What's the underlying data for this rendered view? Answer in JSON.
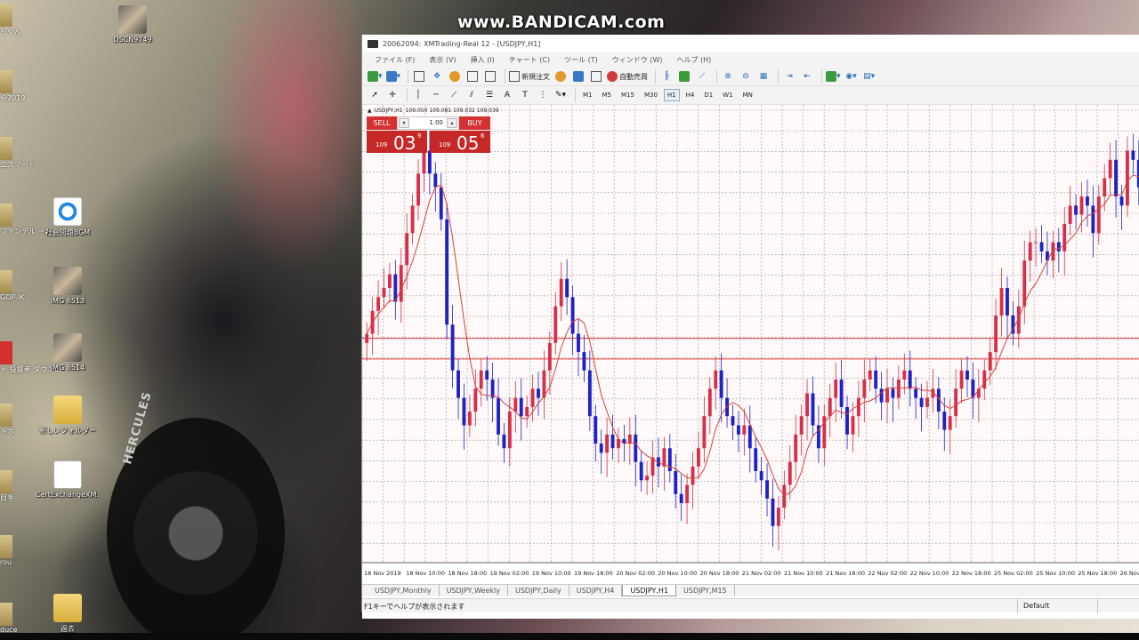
{
  "watermark": "www.BANDICAM.com",
  "desktop": {
    "icons": [
      {
        "label": "DSCN9749",
        "kind": "photo"
      },
      {
        "label": "社会問題BGM",
        "kind": "blue"
      },
      {
        "label": "IMG 6513",
        "kind": "photo"
      },
      {
        "label": "IMG 6514",
        "kind": "photo"
      },
      {
        "label": "新しいフォルダー",
        "kind": "folder"
      },
      {
        "label": "CertExchangeXM...",
        "kind": "pdf"
      },
      {
        "label": "過去",
        "kind": "folder"
      }
    ],
    "edge_labels": [
      "ちゃん",
      "会2019",
      "エスマート",
      "ファンデル ーム",
      "GOP-IK",
      "ト 投資者 ダウンロー...",
      "トホ",
      "目手",
      "rou",
      "duce"
    ],
    "tire_text": "HERCULES"
  },
  "app": {
    "title": "20062094: XMTrading-Real 12 - [USDJPY,H1]",
    "menu": [
      "ファイル (F)",
      "表示 (V)",
      "挿入 (I)",
      "チャート (C)",
      "ツール (T)",
      "ウィンドウ (W)",
      "ヘルプ (H)"
    ],
    "toolbar": {
      "new_order": "新規注文",
      "auto_trade": "自動売買"
    },
    "timeframes": [
      "M1",
      "M5",
      "M15",
      "M30",
      "H1",
      "H4",
      "D1",
      "W1",
      "MN"
    ],
    "active_timeframe": "H1",
    "symbol_line": {
      "arrow": "▲",
      "symbol": "USDJPY,H1",
      "values": "109.050 109.081 109.032 109.039"
    },
    "trade_panel": {
      "sell_label": "SELL",
      "buy_label": "BUY",
      "lot": "1.00",
      "sell_price": {
        "prefix": "109",
        "big": "03",
        "sup": "9"
      },
      "buy_price": {
        "prefix": "109",
        "big": "05",
        "sup": "6"
      }
    },
    "tabs": [
      "USDJPY,Monthly",
      "USDJPY,Weekly",
      "USDJPY,Daily",
      "USDJPY,H4",
      "USDJPY,H1",
      "USDJPY,M15"
    ],
    "active_tab": "USDJPY,H1",
    "status": {
      "help": "F1キーでヘルプが表示されます",
      "profile": "Default"
    }
  },
  "colors": {
    "bull_candle": "#d62f48",
    "bear_candle": "#1f22c2",
    "ma_line": "#d6413a",
    "hline": "#e03c3c",
    "grid": "#9a9a9a",
    "chart_bg": "#fff9f9"
  },
  "chart_data": {
    "type": "candlestick",
    "title": "",
    "symbol": "USDJPY",
    "timeframe": "H1",
    "x_labels": [
      "18 Nov 2019",
      "18 Nov 10:00",
      "18 Nov 18:00",
      "19 Nov 02:00",
      "19 Nov 10:00",
      "19 Nov 18:00",
      "20 Nov 02:00",
      "20 Nov 10:00",
      "20 Nov 18:00",
      "21 Nov 02:00",
      "21 Nov 10:00",
      "21 Nov 18:00",
      "22 Nov 02:00",
      "22 Nov 10:00",
      "22 Nov 18:00",
      "25 Nov 02:00",
      "25 Nov 10:00",
      "25 Nov 18:00",
      "26 Nov"
    ],
    "ylim": [
      108.3,
      109.3
    ],
    "grid": true,
    "horizontal_lines": [
      108.79,
      108.745
    ],
    "closes": [
      108.8,
      108.85,
      108.88,
      108.9,
      108.93,
      108.87,
      108.95,
      109.02,
      109.08,
      109.15,
      109.2,
      109.15,
      109.12,
      109.05,
      108.82,
      108.72,
      108.66,
      108.6,
      108.63,
      108.68,
      108.72,
      108.7,
      108.66,
      108.58,
      108.55,
      108.63,
      108.66,
      108.62,
      108.64,
      108.68,
      108.66,
      108.72,
      108.78,
      108.86,
      108.92,
      108.88,
      108.8,
      108.76,
      108.72,
      108.62,
      108.56,
      108.54,
      108.58,
      108.55,
      108.57,
      108.56,
      108.58,
      108.52,
      108.48,
      108.49,
      108.53,
      108.51,
      108.55,
      108.5,
      108.45,
      108.43,
      108.47,
      108.51,
      108.55,
      108.62,
      108.68,
      108.72,
      108.66,
      108.62,
      108.6,
      108.58,
      108.6,
      108.55,
      108.5,
      108.48,
      108.44,
      108.38,
      108.42,
      108.47,
      108.52,
      108.58,
      108.62,
      108.67,
      108.6,
      108.55,
      108.62,
      108.66,
      108.7,
      108.64,
      108.58,
      108.62,
      108.66,
      108.7,
      108.72,
      108.68,
      108.65,
      108.68,
      108.66,
      108.7,
      108.72,
      108.68,
      108.66,
      108.64,
      108.66,
      108.68,
      108.63,
      108.59,
      108.62,
      108.68,
      108.72,
      108.7,
      108.66,
      108.68,
      108.72,
      108.76,
      108.84,
      108.9,
      108.84,
      108.8,
      108.86,
      108.96,
      109.0,
      109.0,
      108.98,
      108.96,
      109.0,
      108.98,
      109.04,
      109.08,
      109.06,
      109.1,
      109.08,
      109.02,
      109.1,
      109.14,
      109.18,
      109.1,
      109.08,
      109.2,
      109.18,
      109.12
    ],
    "ma_period": 6
  }
}
